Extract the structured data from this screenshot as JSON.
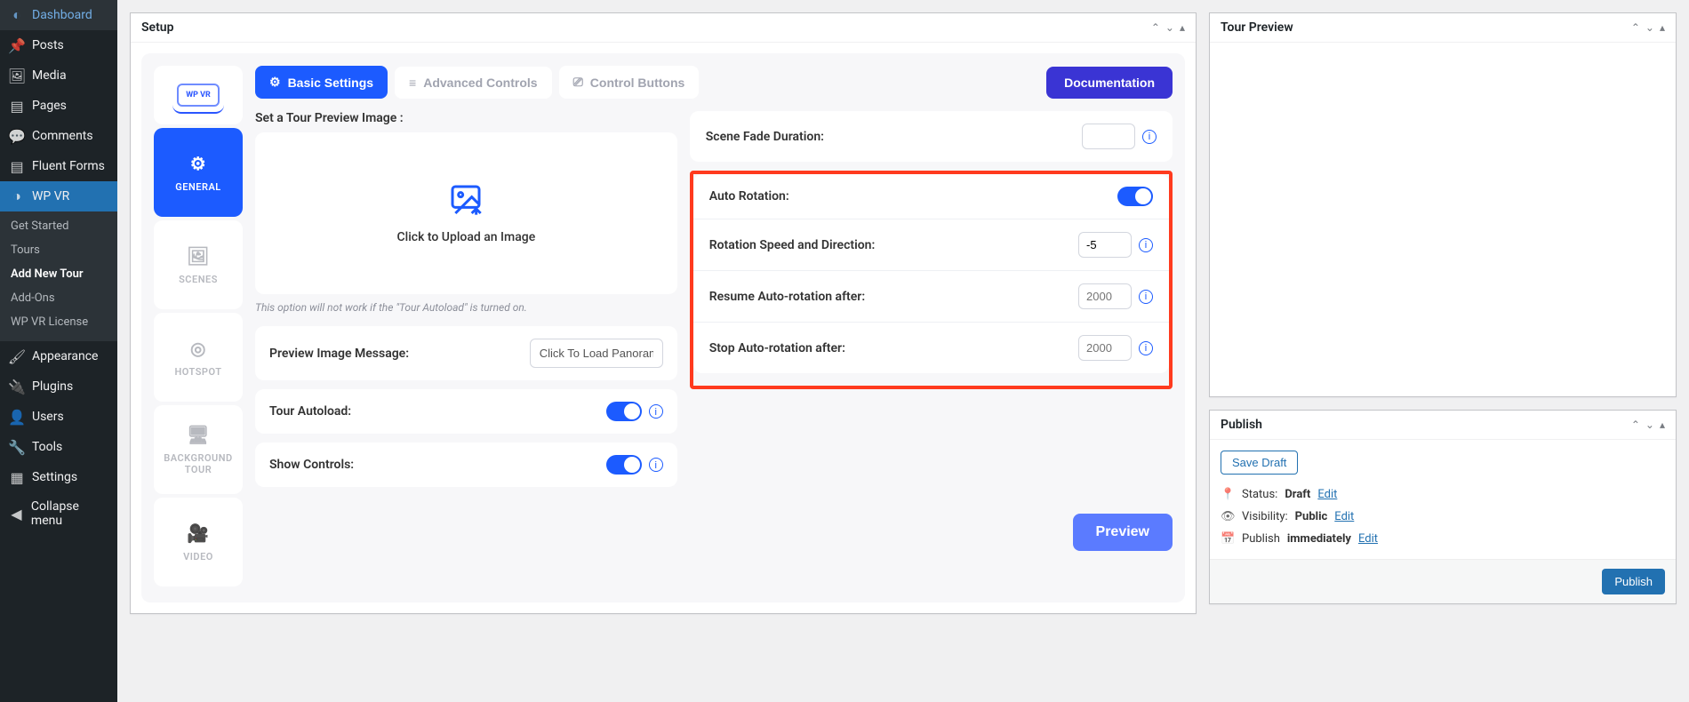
{
  "sidebar": {
    "items": [
      {
        "icon": "◐",
        "label": "Dashboard"
      },
      {
        "icon": "✎",
        "label": "Posts"
      },
      {
        "icon": "▣",
        "label": "Media"
      },
      {
        "icon": "▢",
        "label": "Pages"
      },
      {
        "icon": "✉",
        "label": "Comments"
      },
      {
        "icon": "▤",
        "label": "Fluent Forms"
      },
      {
        "icon": "◑",
        "label": "WP VR"
      }
    ],
    "sub": [
      {
        "label": "Get Started"
      },
      {
        "label": "Tours"
      },
      {
        "label": "Add New Tour",
        "active": true
      },
      {
        "label": "Add-Ons"
      },
      {
        "label": "WP VR License"
      }
    ],
    "items2": [
      {
        "icon": "✎",
        "label": "Appearance"
      },
      {
        "icon": "✦",
        "label": "Plugins"
      },
      {
        "icon": "👤",
        "label": "Users"
      },
      {
        "icon": "✎",
        "label": "Tools"
      },
      {
        "icon": "▦",
        "label": "Settings"
      },
      {
        "icon": "◀",
        "label": "Collapse menu"
      }
    ]
  },
  "setup": {
    "title": "Setup",
    "logo_text": "WP VR",
    "vtabs": {
      "general": "GENERAL",
      "scenes": "SCENES",
      "hotspot": "HOTSPOT",
      "background_tour": "BACKGROUND TOUR",
      "video": "VIDEO"
    },
    "tabs": {
      "basic": "Basic Settings",
      "advanced": "Advanced Controls",
      "control": "Control Buttons"
    },
    "doc_btn": "Documentation",
    "preview_label": "Set a Tour Preview Image :",
    "upload_text": "Click to Upload an Image",
    "autoload_note": "This option will not work if the \"Tour Autoload\" is turned on.",
    "preview_msg_label": "Preview Image Message:",
    "preview_msg_value": "Click To Load Panorama",
    "tour_autoload_label": "Tour Autoload:",
    "show_controls_label": "Show Controls:",
    "scene_fade_label": "Scene Fade Duration:",
    "scene_fade_value": "",
    "auto_rotation_label": "Auto Rotation:",
    "rotation_speed_label": "Rotation Speed and Direction:",
    "rotation_speed_value": "-5",
    "resume_label": "Resume Auto-rotation after:",
    "resume_placeholder": "2000",
    "stop_label": "Stop Auto-rotation after:",
    "stop_placeholder": "2000",
    "preview_btn": "Preview"
  },
  "tour_preview": {
    "title": "Tour Preview"
  },
  "publish": {
    "title": "Publish",
    "save_draft": "Save Draft",
    "status_label": "Status:",
    "status_value": "Draft",
    "visibility_label": "Visibility:",
    "visibility_value": "Public",
    "publish_label": "Publish",
    "publish_value": "immediately",
    "edit": "Edit",
    "publish_btn": "Publish"
  }
}
